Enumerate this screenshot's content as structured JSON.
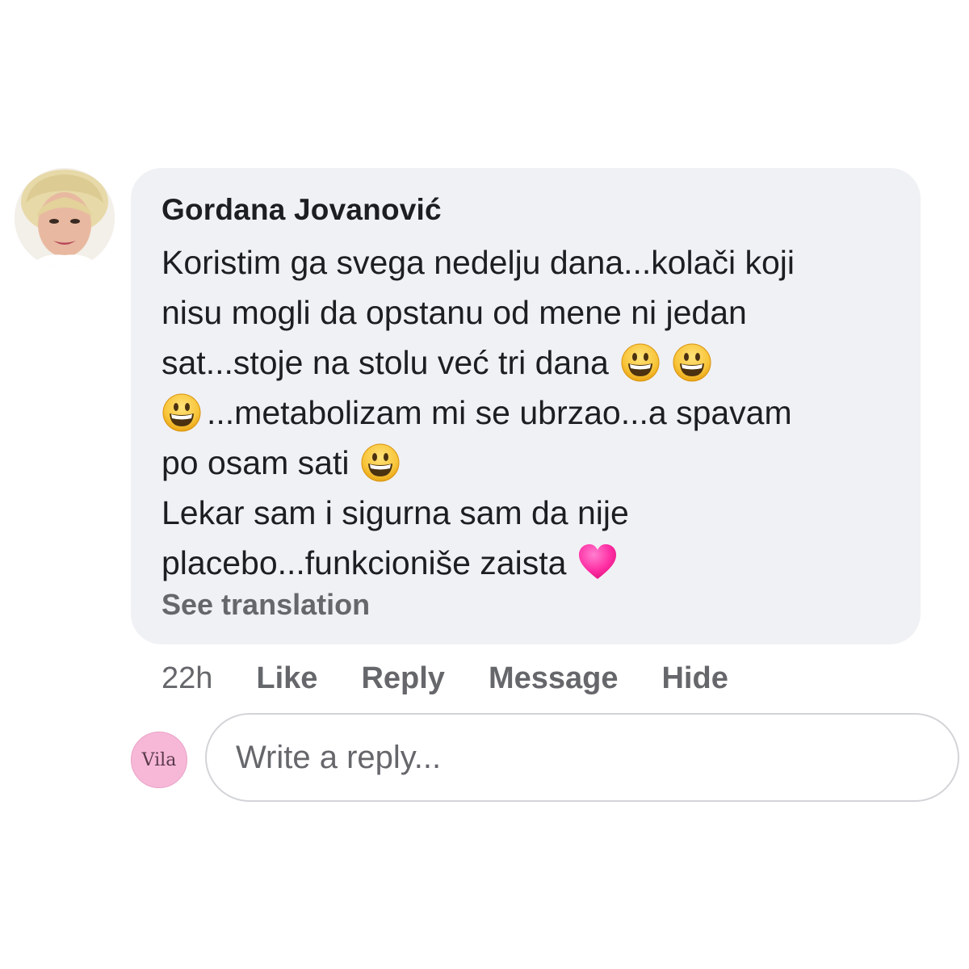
{
  "comment": {
    "author": "Gordana Jovanović",
    "lines": [
      {
        "before": "Koristim ga svega nedelju dana...kolači koji",
        "after": ""
      },
      {
        "before": "nisu mogli da opstanu od mene ni jedan",
        "after": ""
      },
      {
        "before": "sat...stoje na stolu već tri dana",
        "after": ""
      },
      {
        "before": "",
        "after": "...metabolizam mi se ubrzao...a spavam"
      },
      {
        "before": "po osam sati",
        "after": ""
      },
      {
        "before": "Lekar sam i sigurna sam da nije",
        "after": ""
      },
      {
        "before": "placebo...funkcioniše zaista",
        "after": ""
      }
    ],
    "emojis": [
      "grinning-face-emoji",
      "grinning-face-emoji",
      "grinning-face-emoji",
      "grinning-face-emoji",
      "pink-heart-emoji"
    ],
    "see_translation": "See translation"
  },
  "actions": {
    "time": "22h",
    "like": "Like",
    "reply": "Reply",
    "message": "Message",
    "hide": "Hide"
  },
  "reply_box": {
    "avatar_text": "Vila",
    "placeholder": "Write a reply..."
  },
  "colors": {
    "bubble": "#f0f1f5",
    "text": "#1c1e21",
    "secondary": "#65676b",
    "reply_avatar": "#f7b8d8",
    "heart": "#ff2fa4"
  }
}
